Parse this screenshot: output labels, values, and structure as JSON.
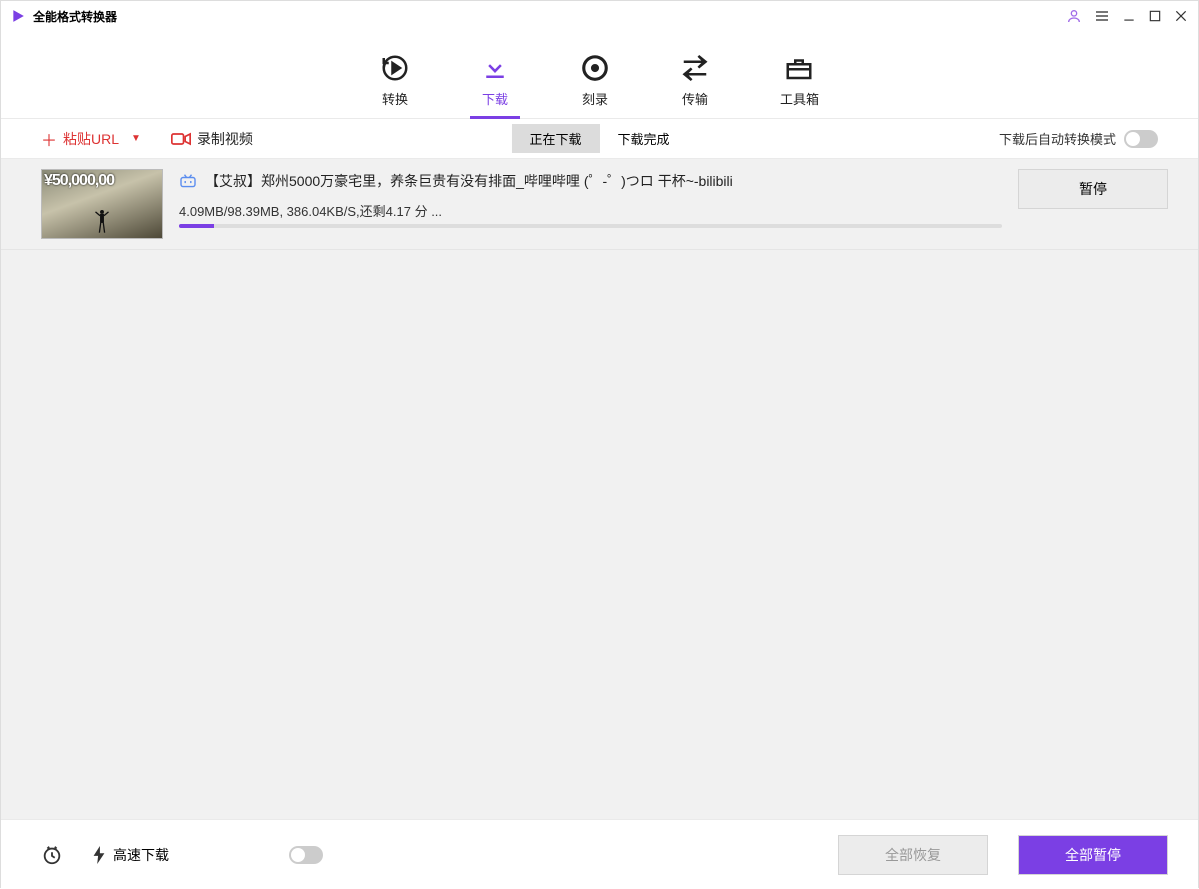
{
  "titlebar": {
    "title": "全能格式转换器"
  },
  "mainnav": {
    "items": [
      {
        "label": "转换"
      },
      {
        "label": "下载"
      },
      {
        "label": "刻录"
      },
      {
        "label": "传输"
      },
      {
        "label": "工具箱"
      }
    ],
    "active_index": 1
  },
  "subbar": {
    "paste_label": "粘贴URL",
    "record_label": "录制视频",
    "tabs": [
      {
        "label": "正在下载",
        "active": true
      },
      {
        "label": "下载完成",
        "active": false
      }
    ],
    "auto_convert_label": "下载后自动转换模式"
  },
  "downloads": [
    {
      "title": "【艾叔】郑州5000万豪宅里，养条巨贵有没有排面_哔哩哔哩 (゜-゜)つロ 干杯~-bilibili",
      "stats": "4.09MB/98.39MB, 386.04KB/S,还剩4.17 分 ...",
      "progress_pct": 4.2,
      "thumb_text": "¥50,000,00",
      "pause_label": "暂停"
    }
  ],
  "footer": {
    "highspeed_label": "高速下载",
    "resume_all": "全部恢复",
    "pause_all": "全部暂停"
  }
}
